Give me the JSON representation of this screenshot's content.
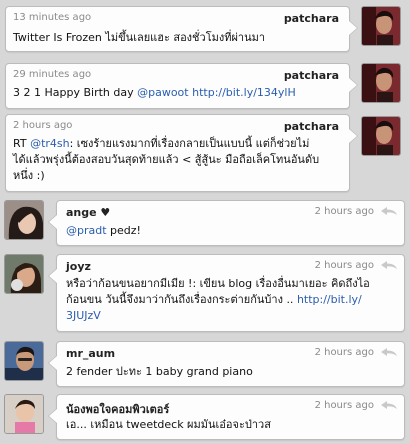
{
  "tweets": [
    {
      "kind": "own",
      "time": "13 minutes ago",
      "author": "patchara",
      "text": "Twitter Is Frozen ไม่ขึ้นเลยแฮะ สองชั่วโมงที่ผ่านมา"
    },
    {
      "kind": "own",
      "time": "29 minutes ago",
      "author": "patchara",
      "text_before": "3 2 1 Happy Birth day ",
      "mention": "@pawoot",
      "link": "http://bit.ly/134ylH"
    },
    {
      "kind": "own",
      "time": "2 hours ago",
      "author": "patchara",
      "prefix": "RT ",
      "mention": "@tr4sh",
      "line1_rest": ": เซงร้ายแรงมากที่เรื่องกลายเป็นแบบนี้ แต่ก็ช่วยไม่",
      "line2": "ได้แล้วพรุ่งนี้ต้องสอบวันสุดท้ายแล้ว < สู้สู้นะ มือถือเล็คโทนอันดับ",
      "line3": "หนึ่ง :)"
    },
    {
      "kind": "other",
      "author": "ange ♥",
      "time": "2 hours ago",
      "mention": "@pradt",
      "text_after": " pedz!"
    },
    {
      "kind": "other",
      "author": "joyz",
      "time": "2 hours ago",
      "line1": "หรือว่าก้อนขนอยากมีเมีย !: เขียน blog เรื่องอื่นมาเยอะ คิดถึงไอ",
      "line2_text": "ก้อนขน วันนี้จึงมาว่ากันถึงเรื่องกระต่ายกันบ้าง .. ",
      "line2_link": "http://bit.ly/",
      "line3_link": "3JUJzV"
    },
    {
      "kind": "other",
      "author": "mr_aum",
      "time": "2 hours ago",
      "text": "2 fender ปะทะ 1 baby grand piano"
    },
    {
      "kind": "other",
      "author": "น้องพอใจคอมพิวเตอร์",
      "time": "2 hours ago",
      "text": "เอ... เหมือน tweetdeck ผมมันเอ๋อจะป่าวส"
    }
  ],
  "colors": {
    "link": "#2a5db0",
    "timestamp": "#8a8a8a",
    "background": "#d7d7d7"
  }
}
